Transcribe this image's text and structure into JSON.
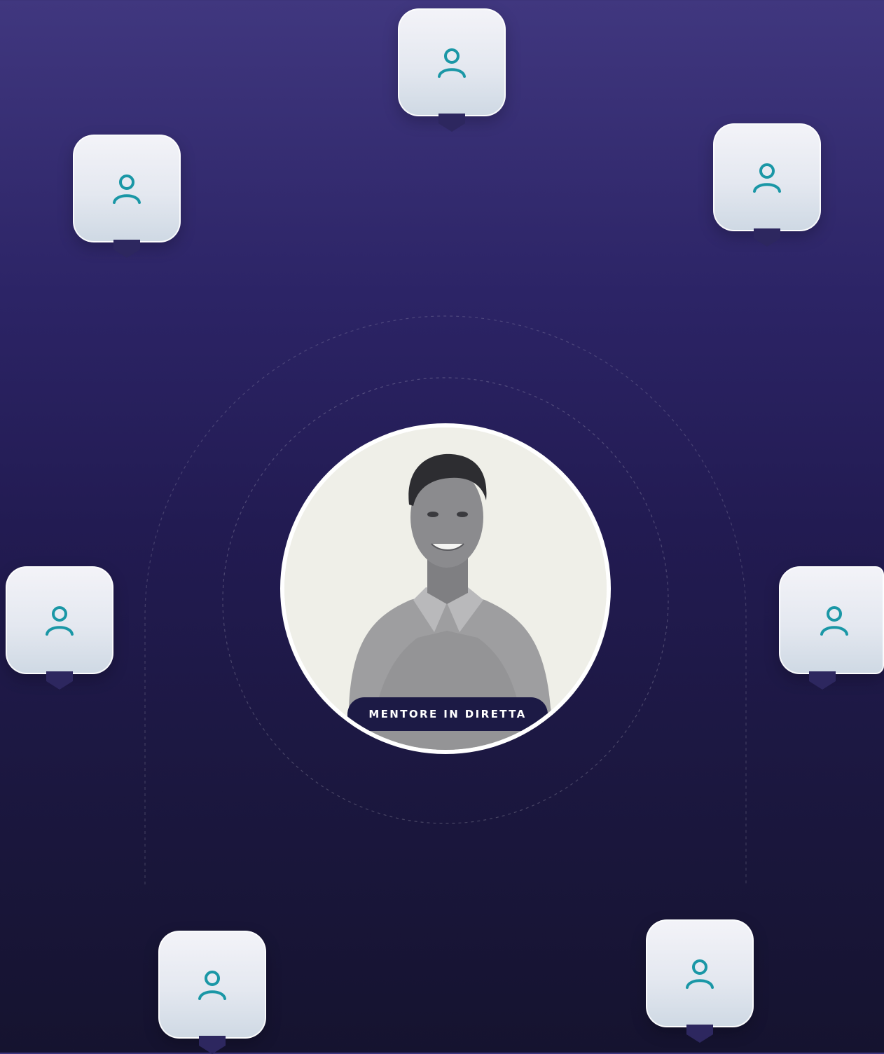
{
  "mentor": {
    "badge_label": "MENTORE IN DIRETTA"
  },
  "participants": [
    {
      "icon": "user-icon"
    },
    {
      "icon": "user-icon"
    },
    {
      "icon": "user-icon"
    },
    {
      "icon": "user-icon"
    },
    {
      "icon": "user-icon"
    },
    {
      "icon": "user-icon"
    },
    {
      "icon": "user-icon"
    }
  ],
  "colors": {
    "background_top": "#40377f",
    "background_bottom": "#15132f",
    "icon_teal": "#1a97a6",
    "pin": "#2d275f",
    "badge": "#1c1a45"
  }
}
